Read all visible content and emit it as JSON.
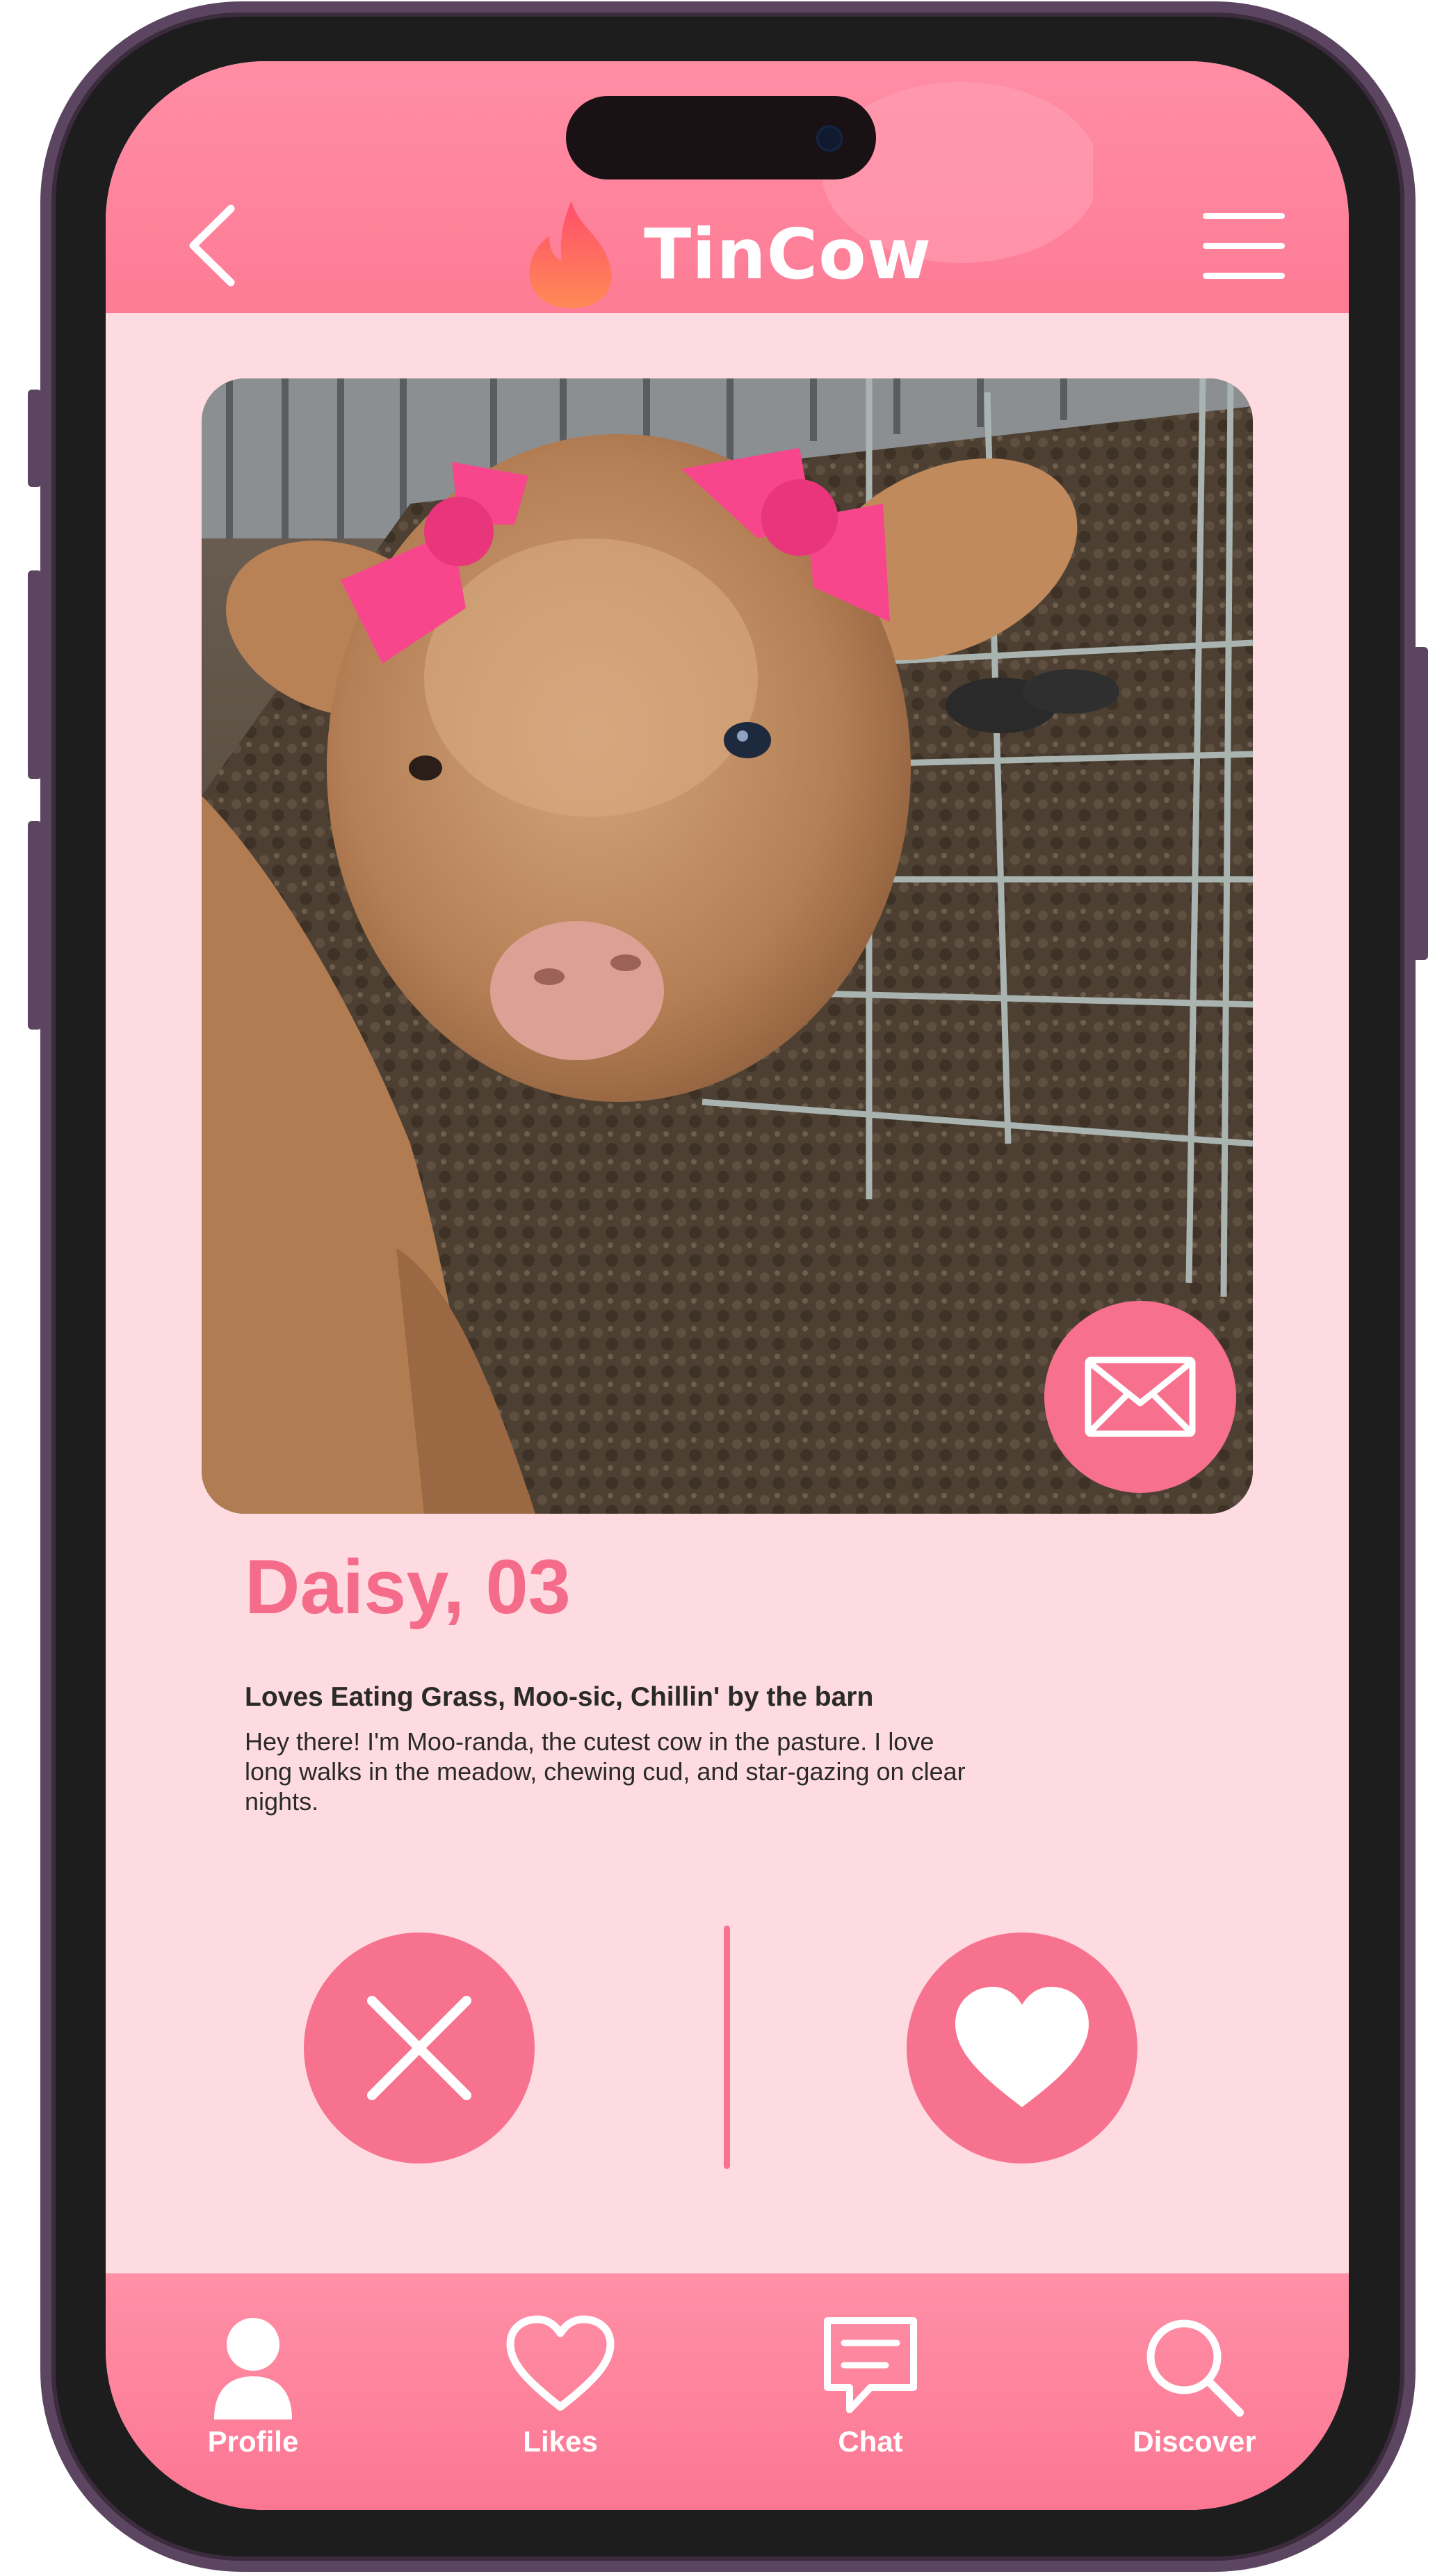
{
  "app": {
    "name": "TinCow",
    "accent_color": "#fd7b95",
    "background_color": "#fedbe1"
  },
  "header": {
    "back_icon": "chevron-left-icon",
    "menu_icon": "hamburger-menu-icon",
    "logo_icon": "flame-icon",
    "title": "TinCow"
  },
  "profile": {
    "photo": "calf-with-pink-bows-photo",
    "name_age": "Daisy, 03",
    "interests": "Loves Eating Grass, Moo-sic, Chillin' by the barn",
    "bio": "Hey there! I'm Moo-randa, the cutest cow in the pasture. I love long walks in the meadow, chewing cud, and star-gazing on clear nights.",
    "message_icon": "envelope-icon"
  },
  "actions": {
    "reject_icon": "close-x-icon",
    "like_icon": "heart-icon"
  },
  "nav": {
    "items": [
      {
        "label": "Profile",
        "icon": "user-icon"
      },
      {
        "label": "Likes",
        "icon": "heart-outline-icon"
      },
      {
        "label": "Chat",
        "icon": "chat-bubble-icon"
      },
      {
        "label": "Discover",
        "icon": "search-icon"
      }
    ]
  }
}
